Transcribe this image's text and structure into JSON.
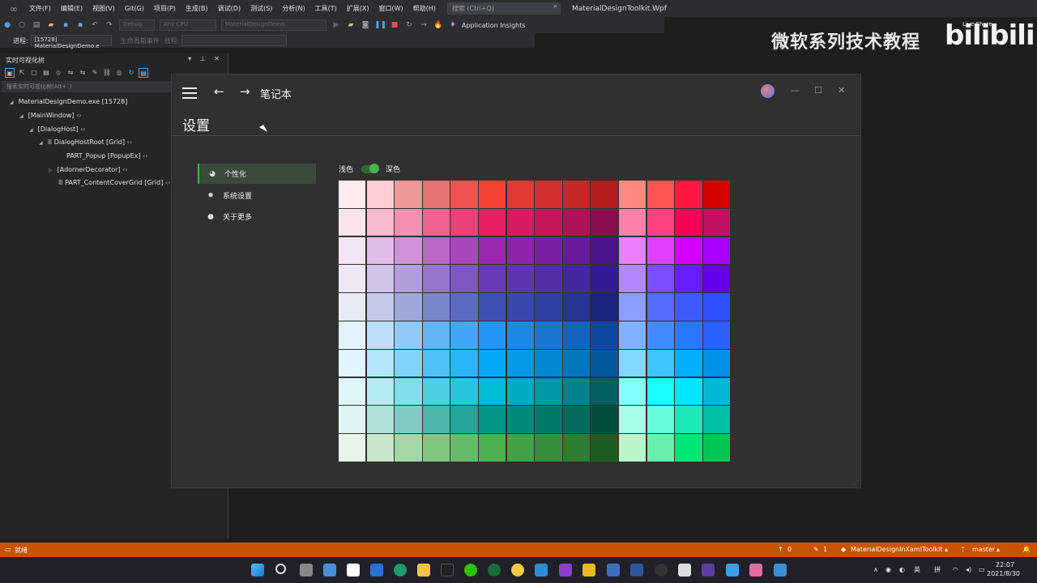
{
  "vs": {
    "menu": [
      "文件(F)",
      "编辑(E)",
      "视图(V)",
      "Git(G)",
      "项目(P)",
      "生成(B)",
      "调试(D)",
      "测试(S)",
      "分析(N)",
      "工具(T)",
      "扩展(X)",
      "窗口(W)",
      "帮助(H)"
    ],
    "search_placeholder": "搜索 (Ctrl+Q)",
    "project_name": "MaterialDesignToolkit.Wpf",
    "config": "Debug",
    "platform": "Any CPU",
    "startup": "MaterialDesignDemo",
    "app_insights": "Application Insights",
    "process_label": "进程:",
    "process_value": "[15728] MaterialDesignDemo.e",
    "lifecycle_label": "生命周期事件",
    "thread_label": "线程:"
  },
  "overlay": {
    "watermark": "微软系列技术教程",
    "bili": "bilibili",
    "liveshare": "Live Share"
  },
  "tree": {
    "title": "实时可视化树",
    "search_placeholder": "搜索实时可视化树(Alt+`)",
    "nodes": [
      "MaterialDesignDemo.exe [15728]",
      "[MainWindow]",
      "[DialogHost]",
      "DialogHostRoot [Grid]",
      "PART_Popup [PopupEx]",
      "[AdornerDecorator]",
      "PART_ContentCoverGrid [Grid]"
    ]
  },
  "app": {
    "title": "笔记本",
    "page_title": "设置",
    "nav": [
      {
        "label": "个性化",
        "icon": "palette-icon",
        "active": true
      },
      {
        "label": "系统设置",
        "icon": "gear-icon",
        "active": false
      },
      {
        "label": "关于更多",
        "icon": "info-icon",
        "active": false
      }
    ],
    "theme_light": "浅色",
    "theme_dark": "深色",
    "theme_is_dark": true,
    "swatches": [
      [
        "#ffebee",
        "#ffcdd2",
        "#ef9a9a",
        "#e57373",
        "#ef5350",
        "#f44336",
        "#e53935",
        "#d32f2f",
        "#c62828",
        "#b71c1c",
        "#ff8a80",
        "#ff5252",
        "#ff1744",
        "#d50000"
      ],
      [
        "#fce4ec",
        "#f8bbd0",
        "#f48fb1",
        "#f06292",
        "#ec407a",
        "#e91e63",
        "#d81b60",
        "#c2185b",
        "#ad1457",
        "#880e4f",
        "#ff80ab",
        "#ff4081",
        "#f50057",
        "#c51162"
      ],
      [
        "#f3e5f5",
        "#e1bee7",
        "#ce93d8",
        "#ba68c8",
        "#ab47bc",
        "#9c27b0",
        "#8e24aa",
        "#7b1fa2",
        "#6a1b9a",
        "#4a148c",
        "#ea80fc",
        "#e040fb",
        "#d500f9",
        "#aa00ff"
      ],
      [
        "#ede7f6",
        "#d1c4e9",
        "#b39ddb",
        "#9575cd",
        "#7e57c2",
        "#673ab7",
        "#5e35b1",
        "#512da8",
        "#4527a0",
        "#311b92",
        "#b388ff",
        "#7c4dff",
        "#651fff",
        "#6200ea"
      ],
      [
        "#e8eaf6",
        "#c5cae9",
        "#9fa8da",
        "#7986cb",
        "#5c6bc0",
        "#3f51b5",
        "#3949ab",
        "#303f9f",
        "#283593",
        "#1a237e",
        "#8c9eff",
        "#536dfe",
        "#3d5afe",
        "#304ffe"
      ],
      [
        "#e3f2fd",
        "#bbdefb",
        "#90caf9",
        "#64b5f6",
        "#42a5f5",
        "#2196f3",
        "#1e88e5",
        "#1976d2",
        "#1565c0",
        "#0d47a1",
        "#82b1ff",
        "#448aff",
        "#2979ff",
        "#2962ff"
      ],
      [
        "#e1f5fe",
        "#b3e5fc",
        "#81d4fa",
        "#4fc3f7",
        "#29b6f6",
        "#03a9f4",
        "#039be5",
        "#0288d1",
        "#0277bd",
        "#01579b",
        "#80d8ff",
        "#40c4ff",
        "#00b0ff",
        "#0091ea"
      ],
      [
        "#e0f7fa",
        "#b2ebf2",
        "#80deea",
        "#4dd0e1",
        "#26c6da",
        "#00bcd4",
        "#00acc1",
        "#0097a7",
        "#00838f",
        "#006064",
        "#84ffff",
        "#18ffff",
        "#00e5ff",
        "#00b8d4"
      ],
      [
        "#e0f2f1",
        "#b2dfdb",
        "#80cbc4",
        "#4db6ac",
        "#26a69a",
        "#009688",
        "#00897b",
        "#00796b",
        "#00695c",
        "#004d40",
        "#a7ffeb",
        "#64ffda",
        "#1de9b6",
        "#00bfa5"
      ],
      [
        "#e8f5e9",
        "#c8e6c9",
        "#a5d6a7",
        "#81c784",
        "#66bb6a",
        "#4caf50",
        "#43a047",
        "#388e3c",
        "#2e7d32",
        "#1b5e20",
        "#b9f6ca",
        "#69f0ae",
        "#00e676",
        "#00c853"
      ]
    ]
  },
  "status": {
    "ready": "就绪",
    "up_count": "0",
    "edit_count": "1",
    "repo": "MaterialDesignInXamlToolkit",
    "branch": "master"
  },
  "taskbar": {
    "lang": "英",
    "ime": "拼",
    "time": "22:07",
    "date": "2021/8/30"
  }
}
